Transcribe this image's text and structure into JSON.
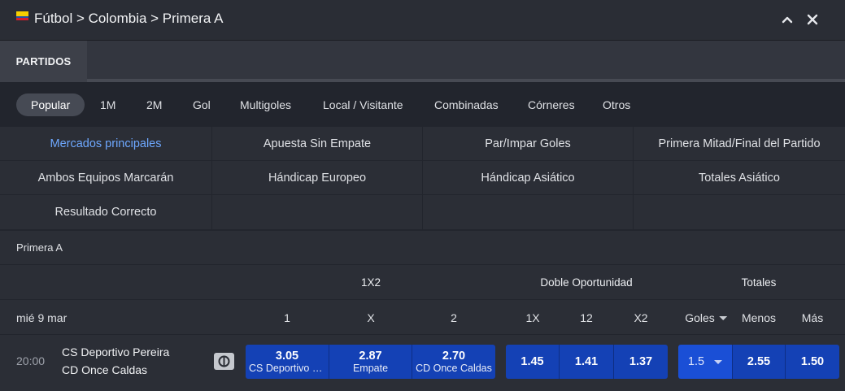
{
  "header": {
    "breadcrumb": "Fútbol > Colombia > Primera A",
    "flag_icon": "colombia-flag-icon",
    "collapse_icon": "chevron-up-icon",
    "close_icon": "close-icon"
  },
  "tabs": {
    "active": "PARTIDOS"
  },
  "filters": [
    "Popular",
    "1M",
    "2M",
    "Gol",
    "Multigoles",
    "Local / Visitante",
    "Combinadas",
    "Córneres",
    "Otros"
  ],
  "markets": [
    "Mercados principales",
    "Apuesta Sin Empate",
    "Par/Impar Goles",
    "Primera Mitad/Final del Partido",
    "Ambos Equipos Marcarán",
    "Hándicap Europeo",
    "Hándicap Asiático",
    "Totales Asiático",
    "Resultado Correcto"
  ],
  "league": "Primera A",
  "groups": {
    "g1": "1X2",
    "g2": "Doble Oportunidad",
    "g3": "Totales"
  },
  "columns": {
    "date": "mié 9 mar",
    "c1": "1",
    "cx": "X",
    "c2": "2",
    "d1x": "1X",
    "d12": "12",
    "dx2": "X2",
    "goles": "Goles",
    "menos": "Menos",
    "mas": "Más"
  },
  "match": {
    "time": "20:00",
    "home": "CS Deportivo Pereira",
    "away": "CD Once Caldas",
    "stream_icon": "stream-icon",
    "odds_1x2": [
      {
        "value": "3.05",
        "label": "CS Deportivo Pereira"
      },
      {
        "value": "2.87",
        "label": "Empate"
      },
      {
        "value": "2.70",
        "label": "CD Once Caldas"
      }
    ],
    "odds_double": [
      "1.45",
      "1.41",
      "1.37"
    ],
    "totals": {
      "line": "1.5",
      "under": "2.55",
      "over": "1.50"
    }
  },
  "colors": {
    "accent_link": "#6ea8ff",
    "odds_button": "#1441b5",
    "background": "#22252d"
  }
}
